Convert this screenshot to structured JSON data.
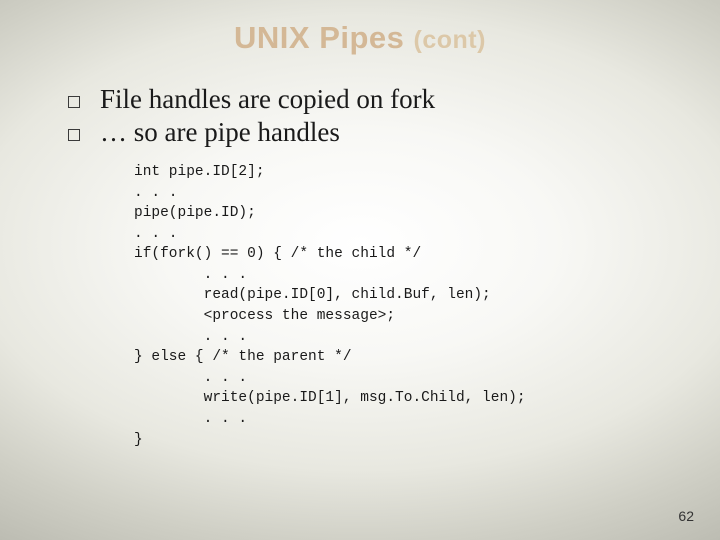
{
  "title": {
    "main": "UNIX Pipes ",
    "cont": "(cont)"
  },
  "bullets": [
    "File handles are copied on fork",
    "… so are pipe handles"
  ],
  "code": "int pipe.ID[2];\n. . .\npipe(pipe.ID);\n. . .\nif(fork() == 0) { /* the child */\n        . . .\n        read(pipe.ID[0], child.Buf, len);\n        <process the message>;\n        . . .\n} else { /* the parent */\n        . . .\n        write(pipe.ID[1], msg.To.Child, len);\n        . . .\n}",
  "page_number": "62"
}
